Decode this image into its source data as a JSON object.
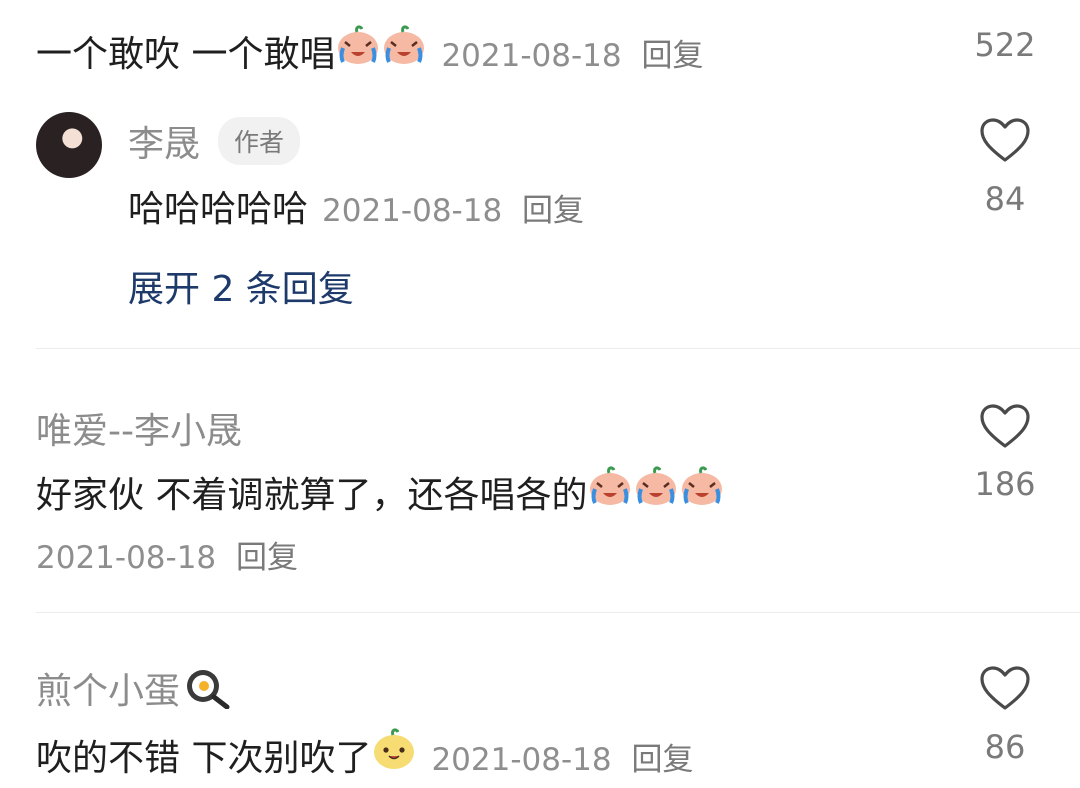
{
  "comments": [
    {
      "text": "一个敢吹 一个敢唱",
      "emojis": [
        "crying-face-icon",
        "crying-face-icon"
      ],
      "date": "2021-08-18",
      "reply_label": "回复",
      "likes": "522"
    },
    {
      "username": "李晟",
      "badge": "作者",
      "text": "哈哈哈哈哈",
      "date": "2021-08-18",
      "reply_label": "回复",
      "likes": "84",
      "expand_label": "展开 2 条回复"
    },
    {
      "username": "唯爱--李小晟",
      "text": "好家伙 不着调就算了，还各唱各的",
      "emojis": [
        "crying-face-icon",
        "crying-face-icon",
        "crying-face-icon"
      ],
      "date": "2021-08-18",
      "reply_label": "回复",
      "likes": "186"
    },
    {
      "username": "煎个小蛋",
      "username_emoji": "frying-pan-egg-icon",
      "text": "吹的不错 下次别吹了",
      "emojis": [
        "smiling-face-icon"
      ],
      "date": "2021-08-18",
      "reply_label": "回复",
      "likes": "86"
    }
  ],
  "colors": {
    "text": "#1f1f1f",
    "meta": "#8e8e8e",
    "link": "#1e3a6b",
    "divider": "#ececec"
  }
}
